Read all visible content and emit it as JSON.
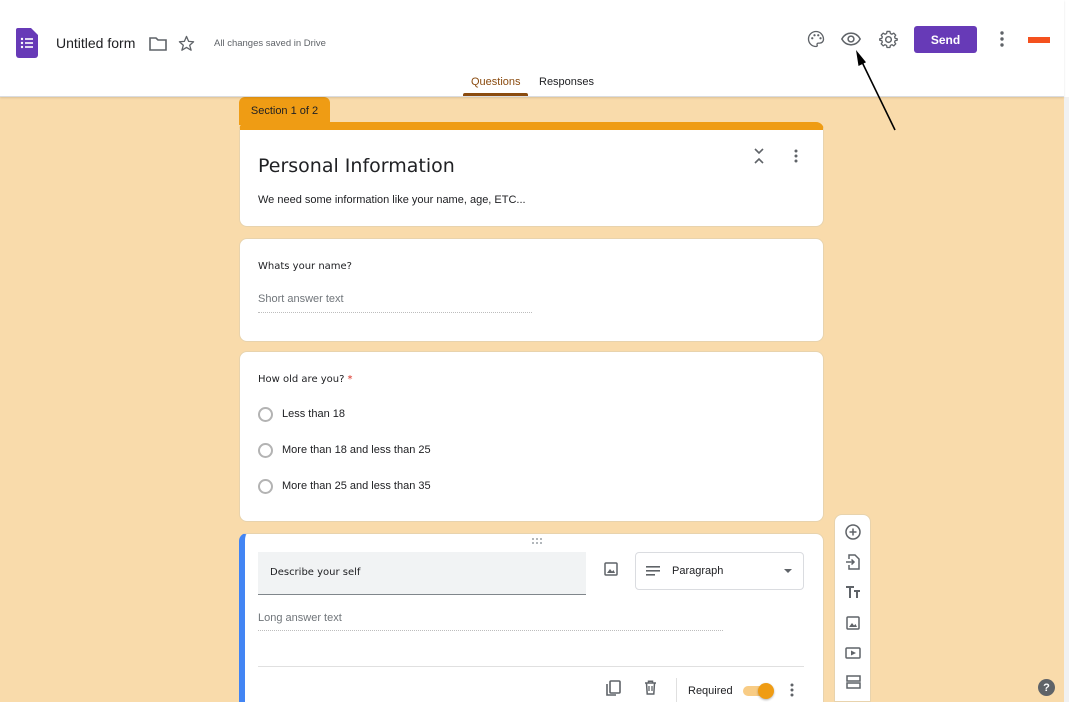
{
  "header": {
    "form_title": "Untitled form",
    "save_status": "All changes saved in Drive",
    "send_label": "Send",
    "account_badge": "",
    "icons": [
      "forms-logo-icon",
      "folder-icon",
      "star-icon",
      "palette-icon",
      "eye-icon",
      "gear-icon",
      "more-vert-icon"
    ],
    "brand_color": "#673ab7"
  },
  "tabs": [
    {
      "label": "Questions",
      "active": true
    },
    {
      "label": "Responses",
      "active": false
    }
  ],
  "section": {
    "tab_label": "Section 1 of 2",
    "title": "Personal Information",
    "description": "We need some information like your name, age, ETC...",
    "accent_color": "#ef9c14",
    "background_color": "#f9dbab"
  },
  "questions": [
    {
      "title": "Whats your name?",
      "type": "Short answer",
      "placeholder": "Short answer text",
      "required": false
    },
    {
      "title": "How old are you?",
      "required_mark": "*",
      "type": "Multiple choice",
      "options": [
        "Less than 18",
        "More than 18 and less than 25",
        "More than 25 and less than 35"
      ],
      "required": true
    },
    {
      "title": "Describe your self",
      "type": "Paragraph",
      "placeholder": "Long answer text",
      "required_label": "Required",
      "required": true
    }
  ],
  "side_toolbar": [
    "add-question-icon",
    "import-questions-icon",
    "add-title-icon",
    "add-image-icon",
    "add-video-icon",
    "add-section-icon"
  ],
  "help_label": "?"
}
